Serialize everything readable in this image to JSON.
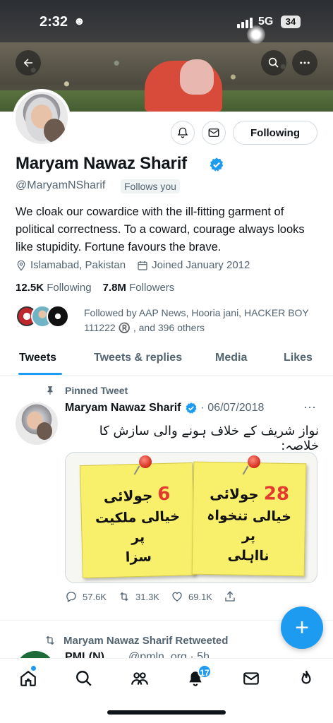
{
  "status_bar": {
    "time": "2:32",
    "time_icon": "☻",
    "network": "5G",
    "battery": "34"
  },
  "profile": {
    "name": "Maryam Nawaz Sharif",
    "handle": "@MaryamNSharif",
    "follows_you": "Follows you",
    "follow_button": "Following",
    "bio": "We cloak our cowardice with the ill-fitting garment of political correctness. To a coward, courage always looks like stupidity. Fortune favours the brave.",
    "location": "Islamabad, Pakistan",
    "joined": "Joined January 2012",
    "following_count": "12.5K",
    "following_label": "Following",
    "followers_count": "7.8M",
    "followers_label": "Followers",
    "followed_by": "Followed by AAP News, Hooria jani, HACKER BOY 111222 ®️ , and 396 others"
  },
  "tabs": [
    "Tweets",
    "Tweets & replies",
    "Media",
    "Likes"
  ],
  "pinned_tweet": {
    "pinned_label": "Pinned Tweet",
    "author": "Maryam Nawaz Sharif",
    "date": "· 06/07/2018",
    "text": "نواز شریف کے خلاف ہونے والی سازش کا خلاصہ:",
    "note_left": {
      "num": "6",
      "date": "جولائی",
      "line1": "خیالی ملکیت",
      "line2": "پر",
      "line3": "سزا"
    },
    "note_right": {
      "num": "28",
      "date": "جولائی",
      "line1": "خیالی تنخواہ",
      "line2": "پر",
      "line3": "نااہلی"
    },
    "replies": "57.6K",
    "retweets": "31.3K",
    "likes": "69.1K"
  },
  "next_tweet": {
    "retweeted_label": "Maryam Nawaz Sharif Retweeted",
    "author": "PML(N)",
    "handle": "@pmln_org · 5h"
  },
  "bottom_nav": {
    "notifications_badge": "17"
  },
  "colors": {
    "accent": "#1d9bf0",
    "text": "#0f1419",
    "muted": "#536471"
  }
}
